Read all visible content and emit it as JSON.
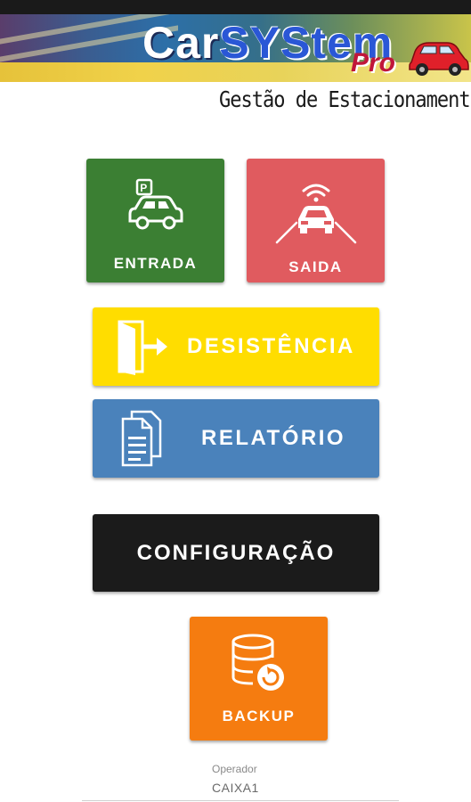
{
  "banner": {
    "title_car": "Car",
    "title_system": "SYStem",
    "title_pro": "Pro",
    "subtitle": "Gestão de Estacionamento"
  },
  "buttons": {
    "entrada": "ENTRADA",
    "saida": "SAIDA",
    "desistencia": "DESISTÊNCIA",
    "relatorio": "RELATÓRIO",
    "configuracao": "CONFIGURAÇÃO",
    "backup": "BACKUP"
  },
  "icons": {
    "entrada": "parking-car-icon",
    "saida": "car-exit-signal-icon",
    "desistencia": "door-exit-icon",
    "relatorio": "documents-icon",
    "backup": "database-refresh-icon"
  },
  "colors": {
    "entrada": "#3b7f33",
    "saida": "#e05b5f",
    "desistencia": "#ffdd00",
    "relatorio": "#4a82bb",
    "configuracao": "#1b1b1b",
    "backup": "#f57c10"
  },
  "operator": {
    "label": "Operador",
    "value": "CAIXA1"
  }
}
